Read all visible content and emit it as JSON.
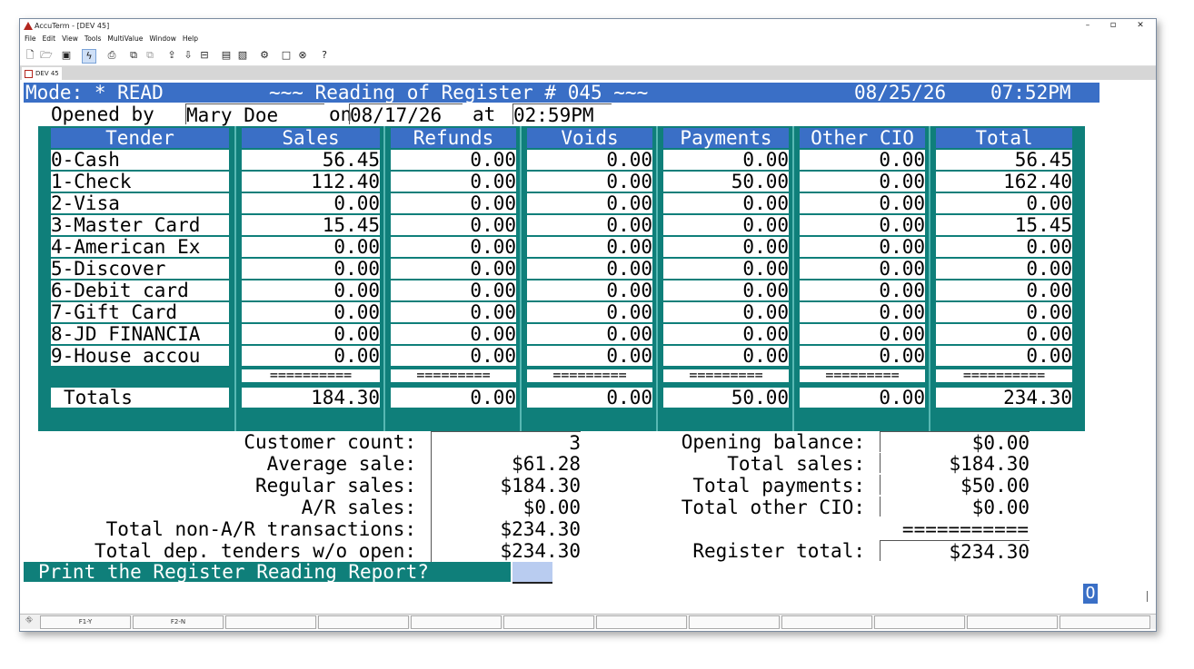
{
  "window": {
    "title": "AccuTerm - [DEV 45]",
    "controls": [
      "–",
      "▫",
      "✕"
    ],
    "menu": [
      "File",
      "Edit",
      "View",
      "Tools",
      "MultiValue",
      "Window",
      "Help"
    ],
    "tab_label": "DEV 45"
  },
  "header": {
    "mode": "Mode: * READ",
    "title": "~~~ Reading of Register # 045 ~~~",
    "date": "08/25/26",
    "time": "07:52PM"
  },
  "opened": {
    "prefix": "Opened by",
    "name": "Mary Doe",
    "on_label": "on",
    "date": "08/17/26",
    "at_label": "at",
    "time": "02:59PM"
  },
  "table": {
    "columns": [
      "Tender",
      "Sales",
      "Refunds",
      "Voids",
      "Payments",
      "Other CIO",
      "Total"
    ],
    "rows": [
      [
        "0-Cash",
        "56.45",
        "0.00",
        "0.00",
        "0.00",
        "0.00",
        "56.45"
      ],
      [
        "1-Check",
        "112.40",
        "0.00",
        "0.00",
        "50.00",
        "0.00",
        "162.40"
      ],
      [
        "2-Visa",
        "0.00",
        "0.00",
        "0.00",
        "0.00",
        "0.00",
        "0.00"
      ],
      [
        "3-Master Card",
        "15.45",
        "0.00",
        "0.00",
        "0.00",
        "0.00",
        "15.45"
      ],
      [
        "4-American Ex",
        "0.00",
        "0.00",
        "0.00",
        "0.00",
        "0.00",
        "0.00"
      ],
      [
        "5-Discover",
        "0.00",
        "0.00",
        "0.00",
        "0.00",
        "0.00",
        "0.00"
      ],
      [
        "6-Debit card",
        "0.00",
        "0.00",
        "0.00",
        "0.00",
        "0.00",
        "0.00"
      ],
      [
        "7-Gift Card",
        "0.00",
        "0.00",
        "0.00",
        "0.00",
        "0.00",
        "0.00"
      ],
      [
        "8-JD FINANCIA",
        "0.00",
        "0.00",
        "0.00",
        "0.00",
        "0.00",
        "0.00"
      ],
      [
        "9-House accou",
        "0.00",
        "0.00",
        "0.00",
        "0.00",
        "0.00",
        "0.00"
      ]
    ],
    "separators": [
      "==========",
      "=========",
      "=========",
      "=========",
      "=========",
      "=========="
    ],
    "totals": [
      "Totals",
      "184.30",
      "0.00",
      "0.00",
      "50.00",
      "0.00",
      "234.30"
    ]
  },
  "summary_left": [
    {
      "label": "Customer count:",
      "value": "3"
    },
    {
      "label": "Average sale:",
      "value": "$61.28"
    },
    {
      "label": "Regular sales:",
      "value": "$184.30"
    },
    {
      "label": "A/R sales:",
      "value": "$0.00"
    },
    {
      "label": "Total non-A/R transactions:",
      "value": "$234.30"
    },
    {
      "label": "Total dep. tenders w/o open:",
      "value": "$234.30"
    }
  ],
  "summary_right": [
    {
      "label": "Opening balance:",
      "value": "$0.00"
    },
    {
      "label": "Total sales:",
      "value": "$184.30"
    },
    {
      "label": "Total payments:",
      "value": "$50.00"
    },
    {
      "label": "Total other CIO:",
      "value": "$0.00"
    },
    {
      "label": "",
      "value": "==========="
    },
    {
      "label": "Register total:",
      "value": "$234.30"
    }
  ],
  "prompt": {
    "text": "Print the Register Reading Report?",
    "input_value": ""
  },
  "indicator": "O",
  "status": {
    "keys": [
      "F1-Y",
      "F2-N",
      "",
      "",
      "",
      "",
      "",
      "",
      "",
      "",
      "",
      ""
    ]
  },
  "colors": {
    "header_blue": "#3a6fc6",
    "teal": "#0f7f7a",
    "input_highlight": "#b9ccf0"
  }
}
